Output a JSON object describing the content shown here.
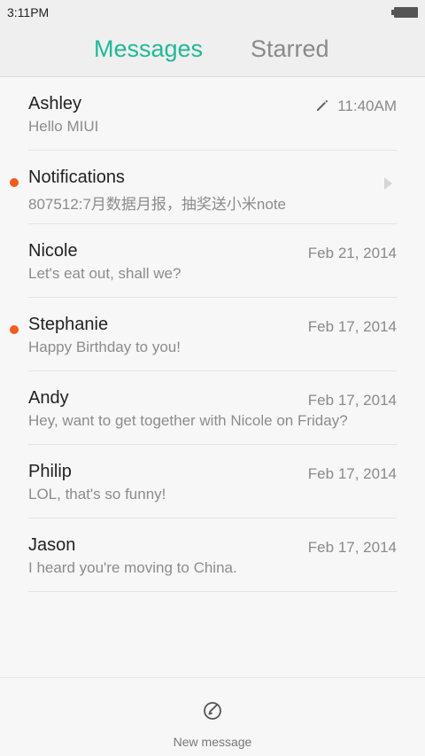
{
  "status_bar": {
    "time": "3:11PM"
  },
  "tabs": {
    "messages": "Messages",
    "starred": "Starred"
  },
  "colors": {
    "accent": "#20b896",
    "unread": "#f35b1c"
  },
  "conversations": [
    {
      "name": "Ashley",
      "preview": "Hello MIUI",
      "date": "11:40AM",
      "draft": true
    },
    {
      "name": "Notifications",
      "preview": "807512:7月数据月报，抽奖送小米note",
      "unread": true,
      "arrow": true
    },
    {
      "name": "Nicole",
      "preview": "Let's eat out, shall we?",
      "date": "Feb 21, 2014"
    },
    {
      "name": "Stephanie",
      "preview": "Happy Birthday to you!",
      "date": "Feb 17, 2014",
      "unread": true
    },
    {
      "name": "Andy",
      "preview": "Hey, want to get together with Nicole on Friday?",
      "date": "Feb 17, 2014"
    },
    {
      "name": "Philip",
      "preview": "LOL, that's so funny!",
      "date": "Feb 17, 2014"
    },
    {
      "name": "Jason",
      "preview": "I heard you're moving to China.",
      "date": "Feb 17, 2014"
    }
  ],
  "bottom_bar": {
    "new_message_label": "New message",
    "icon": "compose-icon"
  }
}
